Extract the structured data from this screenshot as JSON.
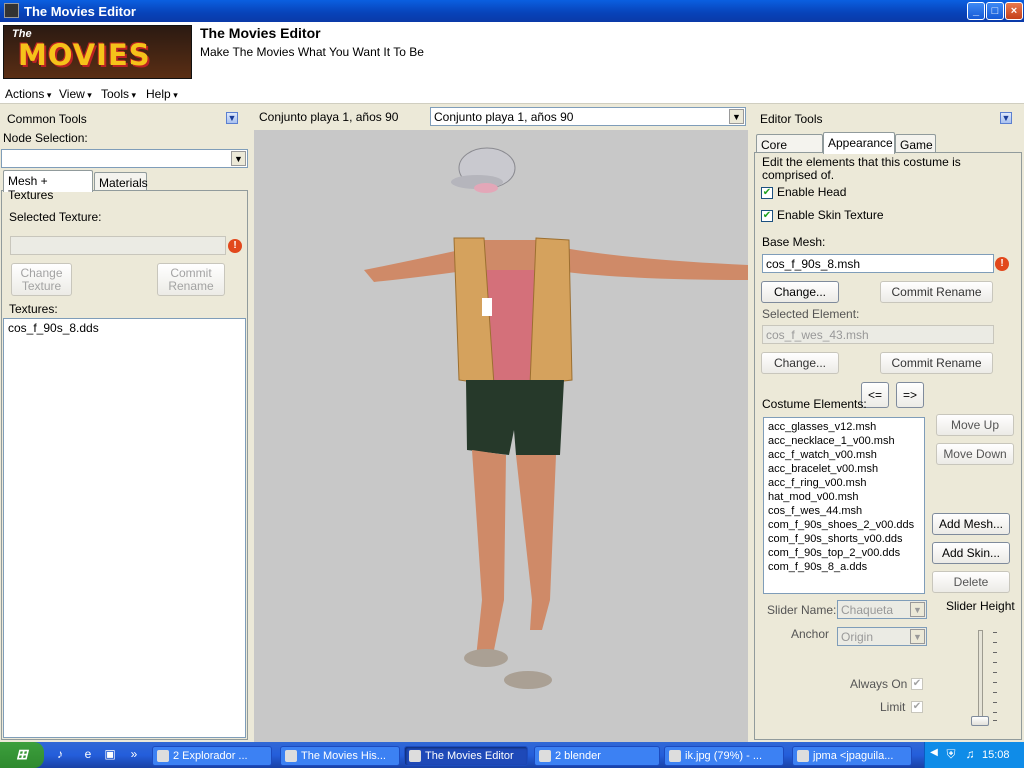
{
  "window": {
    "title": "The Movies Editor",
    "minimize": "_",
    "maximize": "□",
    "close": "×"
  },
  "header": {
    "logo_small": "The",
    "logo_big": "MOVIES",
    "title": "The Movies Editor",
    "subtitle": "Make The Movies What You Want It To Be"
  },
  "menubar": {
    "items": [
      "Actions",
      "View",
      "Tools",
      "Help"
    ]
  },
  "left_panel": {
    "title": "Common Tools",
    "node_selection_label": "Node Selection:",
    "node_selection_value": "",
    "tabs": [
      "Mesh + Textures",
      "Materials"
    ],
    "selected_texture_label": "Selected Texture:",
    "selected_texture_value": "",
    "change_texture_label": "Change Texture",
    "commit_rename_label": "Commit Rename",
    "textures_label": "Textures:",
    "textures": [
      "cos_f_90s_8.dds"
    ]
  },
  "center": {
    "title": "Conjunto playa 1, años 90",
    "combo_value": "Conjunto playa 1, años 90"
  },
  "right_panel": {
    "title": "Editor Tools",
    "tabs": [
      "Core Details",
      "Appearance",
      "Game"
    ],
    "description": "Edit the elements that this costume is comprised of.",
    "enable_head_label": "Enable Head",
    "enable_skin_label": "Enable Skin Texture",
    "base_mesh_label": "Base Mesh:",
    "base_mesh_value": "cos_f_90s_8.msh",
    "change_label": "Change...",
    "commit_rename_label": "Commit Rename",
    "selected_element_label": "Selected Element:",
    "selected_element_value": "cos_f_wes_43.msh",
    "move_left_label": "<=",
    "move_right_label": "=>",
    "costume_elements_label": "Costume Elements:",
    "costume_elements": [
      "acc_glasses_v12.msh",
      "acc_necklace_1_v00.msh",
      "acc_f_watch_v00.msh",
      "acc_bracelet_v00.msh",
      "acc_f_ring_v00.msh",
      "hat_mod_v00.msh",
      "cos_f_wes_44.msh",
      "com_f_90s_shoes_2_v00.dds",
      "com_f_90s_shorts_v00.dds",
      "com_f_90s_top_2_v00.dds",
      "com_f_90s_8_a.dds"
    ],
    "move_up_label": "Move Up",
    "move_down_label": "Move Down",
    "add_mesh_label": "Add Mesh...",
    "add_skin_label": "Add Skin...",
    "delete_label": "Delete",
    "slider_name_label": "Slider Name:",
    "slider_name_value": "Chaqueta",
    "anchor_label": "Anchor",
    "anchor_value": "Origin",
    "slider_height_label": "Slider Height",
    "always_on_label": "Always On",
    "limit_label": "Limit"
  },
  "taskbar": {
    "items": [
      {
        "label": "2 Explorador ...",
        "active": false
      },
      {
        "label": "The Movies His...",
        "active": false
      },
      {
        "label": "The Movies Editor",
        "active": true
      },
      {
        "label": "2 blender",
        "active": false
      },
      {
        "label": "ik.jpg (79%) - ...",
        "active": false
      },
      {
        "label": "jpma <jpaguila...",
        "active": false
      }
    ],
    "clock": "15:08"
  }
}
